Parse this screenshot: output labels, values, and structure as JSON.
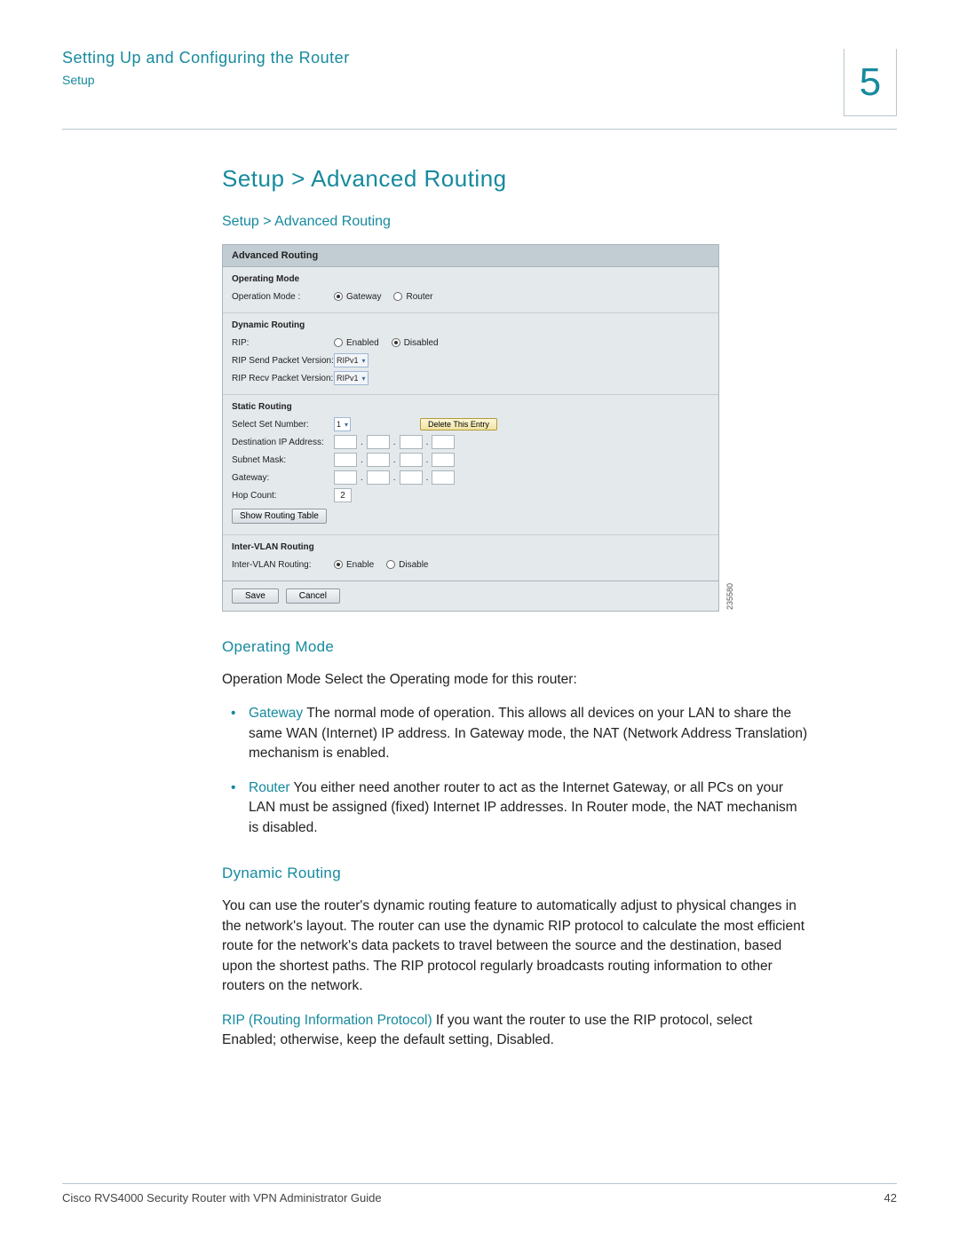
{
  "header": {
    "chapter_title": "Setting Up and Configuring the Router",
    "section_label": "Setup",
    "chapter_number": "5"
  },
  "headings": {
    "h1": "Setup > Advanced Routing",
    "h2": "Setup > Advanced Routing",
    "operating_mode": "Operating Mode",
    "dynamic_routing": "Dynamic Routing"
  },
  "panel": {
    "title": "Advanced Routing",
    "op_mode_hd": "Operating Mode",
    "op_mode_label": "Operation Mode :",
    "op_gateway": "Gateway",
    "op_router": "Router",
    "dyn_hd": "Dynamic Routing",
    "rip_label": "RIP:",
    "enabled": "Enabled",
    "disabled": "Disabled",
    "rip_send_label": "RIP Send Packet Version:",
    "rip_recv_label": "RIP Recv Packet Version:",
    "rip_v1": "RIPv1",
    "static_hd": "Static Routing",
    "select_set_label": "Select Set Number:",
    "select_set_value": "1",
    "delete_entry": "Delete This Entry",
    "dest_ip_label": "Destination IP Address:",
    "subnet_label": "Subnet Mask:",
    "gateway_label": "Gateway:",
    "hop_label": "Hop Count:",
    "hop_value": "2",
    "show_table": "Show Routing Table",
    "vlan_hd": "Inter-VLAN Routing",
    "vlan_label": "Inter-VLAN Routing:",
    "enable": "Enable",
    "disable": "Disable",
    "save": "Save",
    "cancel": "Cancel",
    "image_id": "235580"
  },
  "body": {
    "op_intro": "Operation Mode Select the Operating mode for this router:",
    "bullet1_lead": "Gateway",
    "bullet1_text": " The normal mode of operation. This allows all devices on your LAN to share the same WAN (Internet) IP address. In Gateway mode, the NAT (Network Address Translation) mechanism is enabled.",
    "bullet2_lead": "Router",
    "bullet2_text": " You either need another router to act as the Internet Gateway, or all PCs on your LAN must be assigned (fixed) Internet IP addresses. In Router mode, the NAT mechanism is disabled.",
    "dyn_para": "You can use the router's dynamic routing feature to automatically adjust to physical changes in the network's layout. The router can use the dynamic RIP protocol to calculate the most efficient route for the network's data packets to travel between the source and the destination, based upon the shortest paths. The RIP protocol regularly broadcasts routing information to other routers on the network.",
    "rip_lead": "RIP (Routing Information Protocol)",
    "rip_text": " If you want the router to use the RIP protocol, select Enabled; otherwise, keep the default setting, Disabled."
  },
  "footer": {
    "doc_title": "Cisco RVS4000 Security Router with VPN Administrator Guide",
    "page_num": "42"
  }
}
